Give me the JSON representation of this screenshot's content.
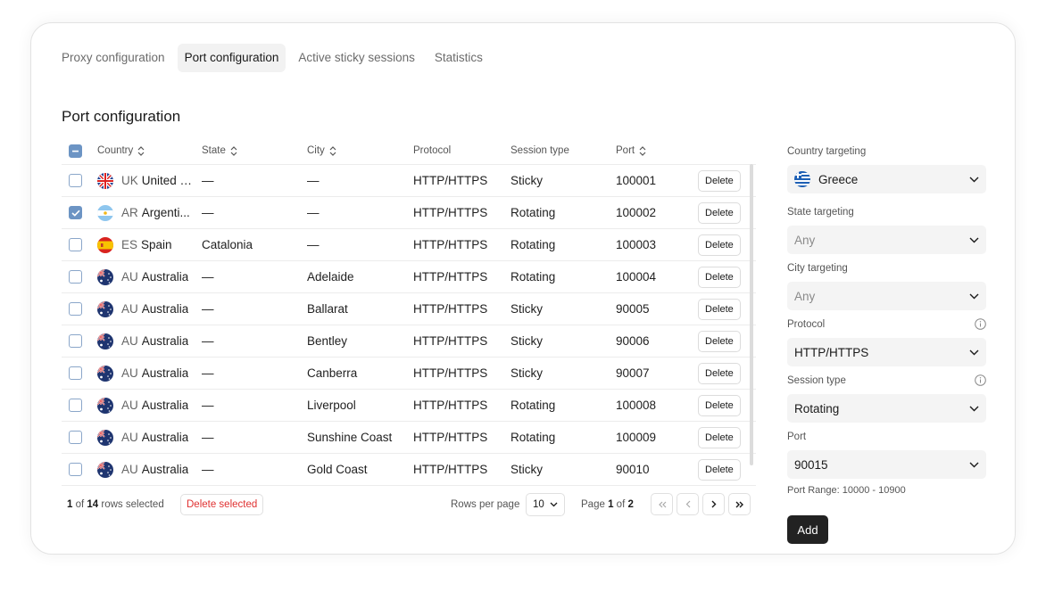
{
  "tabs": [
    {
      "label": "Proxy configuration",
      "active": false
    },
    {
      "label": "Port configuration",
      "active": true
    },
    {
      "label": "Active sticky sessions",
      "active": false
    },
    {
      "label": "Statistics",
      "active": false
    }
  ],
  "section_title": "Port configuration",
  "table": {
    "headers": {
      "country": "Country",
      "state": "State",
      "city": "City",
      "protocol": "Protocol",
      "session_type": "Session type",
      "port": "Port"
    },
    "delete_label": "Delete",
    "rows": [
      {
        "checked": false,
        "flag": "uk",
        "code": "UK",
        "country": "United K...",
        "state": "—",
        "city": "—",
        "protocol": "HTTP/HTTPS",
        "session": "Sticky",
        "port": "100001"
      },
      {
        "checked": true,
        "flag": "ar",
        "code": "AR",
        "country": "Argenti...",
        "state": "—",
        "city": "—",
        "protocol": "HTTP/HTTPS",
        "session": "Rotating",
        "port": "100002"
      },
      {
        "checked": false,
        "flag": "es",
        "code": "ES",
        "country": "Spain",
        "state": "Catalonia",
        "city": "—",
        "protocol": "HTTP/HTTPS",
        "session": "Rotating",
        "port": "100003"
      },
      {
        "checked": false,
        "flag": "au",
        "code": "AU",
        "country": "Australia",
        "state": "—",
        "city": "Adelaide",
        "protocol": "HTTP/HTTPS",
        "session": "Rotating",
        "port": "100004"
      },
      {
        "checked": false,
        "flag": "au",
        "code": "AU",
        "country": "Australia",
        "state": "—",
        "city": "Ballarat",
        "protocol": "HTTP/HTTPS",
        "session": "Sticky",
        "port": "90005"
      },
      {
        "checked": false,
        "flag": "au",
        "code": "AU",
        "country": "Australia",
        "state": "—",
        "city": "Bentley",
        "protocol": "HTTP/HTTPS",
        "session": "Sticky",
        "port": "90006"
      },
      {
        "checked": false,
        "flag": "au",
        "code": "AU",
        "country": "Australia",
        "state": "—",
        "city": "Canberra",
        "protocol": "HTTP/HTTPS",
        "session": "Sticky",
        "port": "90007"
      },
      {
        "checked": false,
        "flag": "au",
        "code": "AU",
        "country": "Australia",
        "state": "—",
        "city": "Liverpool",
        "protocol": "HTTP/HTTPS",
        "session": "Rotating",
        "port": "100008"
      },
      {
        "checked": false,
        "flag": "au",
        "code": "AU",
        "country": "Australia",
        "state": "—",
        "city": "Sunshine Coast",
        "protocol": "HTTP/HTTPS",
        "session": "Rotating",
        "port": "100009"
      },
      {
        "checked": false,
        "flag": "au",
        "code": "AU",
        "country": "Australia",
        "state": "—",
        "city": "Gold Coast",
        "protocol": "HTTP/HTTPS",
        "session": "Sticky",
        "port": "90010"
      }
    ]
  },
  "footer": {
    "selected_count": "1",
    "of_label": "of",
    "total_rows": "14",
    "rows_selected_label": "rows selected",
    "delete_selected_label": "Delete selected",
    "rows_per_page_label": "Rows per page",
    "rows_per_page_value": "10",
    "page_label": "Page",
    "current_page": "1",
    "total_pages": "2"
  },
  "form": {
    "country_label": "Country targeting",
    "country_value": "Greece",
    "state_label": "State targeting",
    "state_value": "Any",
    "city_label": "City targeting",
    "city_value": "Any",
    "protocol_label": "Protocol",
    "protocol_value": "HTTP/HTTPS",
    "session_label": "Session type",
    "session_value": "Rotating",
    "port_label": "Port",
    "port_value": "90015",
    "port_range_hint": "Port Range: 10000 - 10900",
    "add_label": "Add"
  },
  "colors": {
    "checkbox_accent": "#6c94c4",
    "danger": "#e03131",
    "primary_button": "#222222"
  },
  "icons": {
    "sort": "sort-arrows-icon",
    "dropdown": "chevron-down-icon",
    "info": "info-circle-icon",
    "first_page": "double-chevron-left-icon",
    "prev_page": "chevron-left-icon",
    "next_page": "chevron-right-icon",
    "last_page": "double-chevron-right-icon"
  }
}
